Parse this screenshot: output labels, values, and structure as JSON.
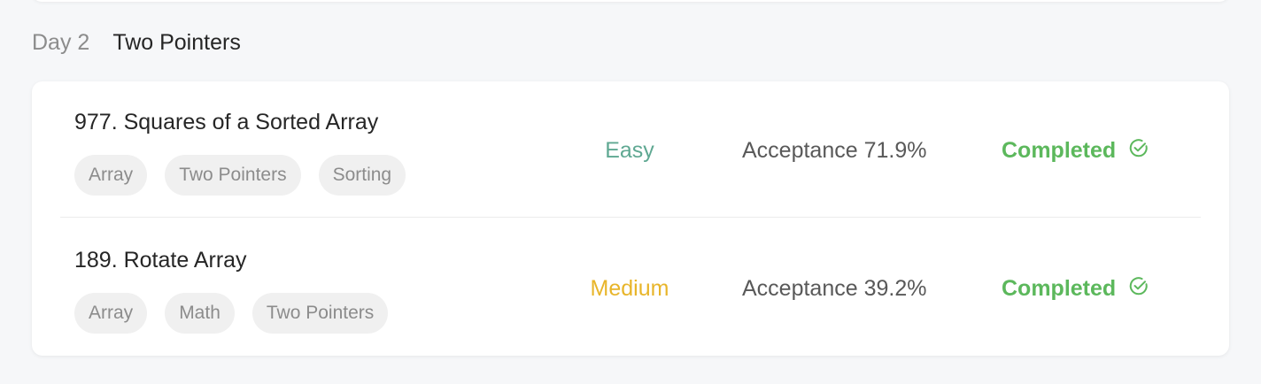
{
  "section": {
    "day": "Day 2",
    "title": "Two Pointers"
  },
  "colors": {
    "easy": "#5fa892",
    "medium": "#e8b52a",
    "completed": "#5cb85c"
  },
  "problems": [
    {
      "title": "977. Squares of a Sorted Array",
      "tags": [
        "Array",
        "Two Pointers",
        "Sorting"
      ],
      "difficulty": "Easy",
      "acceptance": "Acceptance 71.9%",
      "status": "Completed",
      "status_icon": "check-circle-icon"
    },
    {
      "title": "189. Rotate Array",
      "tags": [
        "Array",
        "Math",
        "Two Pointers"
      ],
      "difficulty": "Medium",
      "acceptance": "Acceptance 39.2%",
      "status": "Completed",
      "status_icon": "check-circle-icon"
    }
  ]
}
